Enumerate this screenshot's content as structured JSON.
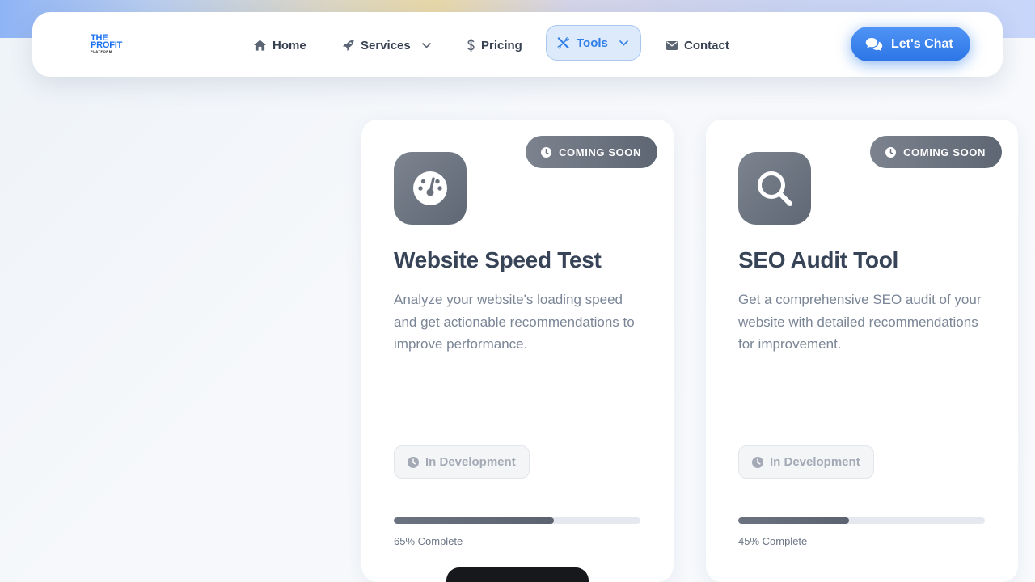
{
  "brand": {
    "logo_line1": "THE",
    "logo_line2": "PROFIT",
    "logo_line3": "PLATFORM",
    "accent_color": "#2f7ee8"
  },
  "nav": {
    "items": [
      {
        "label": "Home",
        "icon": "home-icon"
      },
      {
        "label": "Services",
        "icon": "rocket-icon",
        "has_dropdown": true
      },
      {
        "label": "Pricing",
        "icon": "dollar-icon"
      },
      {
        "label": "Tools",
        "icon": "tools-icon",
        "has_dropdown": true,
        "active": true
      },
      {
        "label": "Contact",
        "icon": "envelope-icon"
      }
    ],
    "cta_label": "Let's Chat",
    "cta_icon": "chat-bubbles-icon"
  },
  "cards": [
    {
      "badge": "COMING SOON",
      "icon": "speedometer-icon",
      "title": "Website Speed Test",
      "description": "Analyze your website's loading speed and get actionable recommendations to improve performance.",
      "status": "In Development",
      "progress": 65,
      "progress_label": "65% Complete"
    },
    {
      "badge": "COMING SOON",
      "icon": "magnifier-icon",
      "title": "SEO Audit Tool",
      "description": "Get a comprehensive SEO audit of your website with detailed recommendations for improvement.",
      "status": "In Development",
      "progress": 45,
      "progress_label": "45% Complete"
    }
  ]
}
